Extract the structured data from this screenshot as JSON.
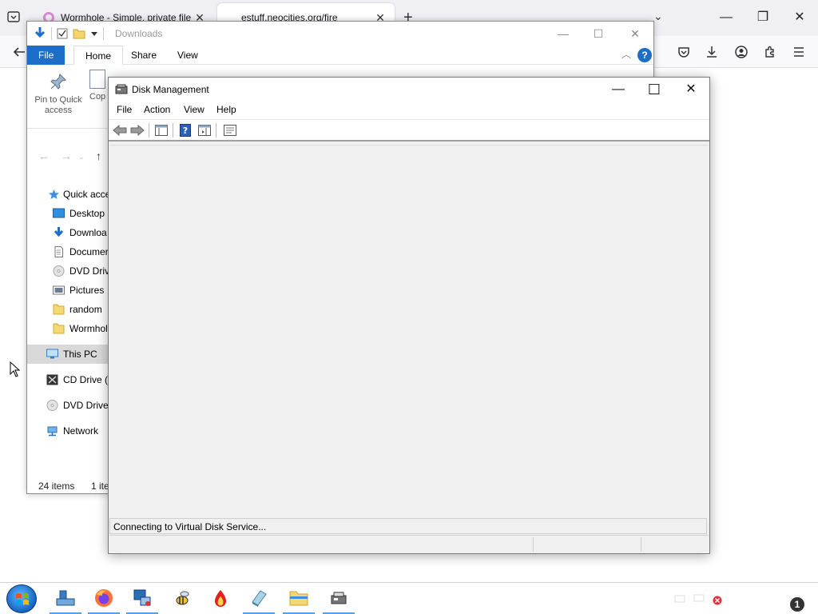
{
  "browser": {
    "tabs": [
      {
        "title": "Wormhole - Simple, private file",
        "active": false
      },
      {
        "title": "estuff.neocities.org/fire",
        "active": true
      }
    ],
    "new_tab_symbol": "+",
    "close_symbol": "✕",
    "overflow_symbol": "⌄",
    "controls": {
      "minimize": "—",
      "restore": "❐",
      "close": "✕"
    },
    "nav_icons": [
      "back-arrow-icon",
      "pocket-icon",
      "download-icon",
      "account-icon",
      "extensions-icon",
      "menu-icon"
    ]
  },
  "explorer": {
    "title": "Downloads",
    "ribbon_tabs": [
      "File",
      "Home",
      "Share",
      "View"
    ],
    "help_symbol": "?",
    "pin_label": "Pin to Quick access",
    "copy_label": "Cop",
    "nav_items": [
      {
        "label": "Quick acce",
        "icon": "star-icon"
      },
      {
        "label": "Desktop",
        "icon": "desktop-icon"
      },
      {
        "label": "Downloa",
        "icon": "download-folder-icon"
      },
      {
        "label": "Documer",
        "icon": "document-icon"
      },
      {
        "label": "DVD Drive",
        "icon": "dvd-icon"
      },
      {
        "label": "Pictures",
        "icon": "pictures-icon"
      },
      {
        "label": "random",
        "icon": "folder-icon"
      },
      {
        "label": "Wormhol",
        "icon": "folder-icon"
      },
      {
        "label": "This PC",
        "icon": "computer-icon",
        "selected": true
      },
      {
        "label": "CD Drive (E",
        "icon": "cd-drive-icon"
      },
      {
        "label": "DVD Drive",
        "icon": "dvd-icon"
      },
      {
        "label": "Network",
        "icon": "network-icon"
      }
    ],
    "status_items": "24 items",
    "status_selected": "1 ite",
    "controls": {
      "minimize": "—",
      "maximize": "☐",
      "close": "✕"
    }
  },
  "disk_management": {
    "title": "Disk Management",
    "menu": [
      "File",
      "Action",
      "View",
      "Help"
    ],
    "status": "Connecting to Virtual Disk Service...",
    "controls": {
      "minimize": "—",
      "maximize": "☐",
      "close": "✕"
    }
  },
  "taskbar": {
    "notification_count": "1"
  }
}
